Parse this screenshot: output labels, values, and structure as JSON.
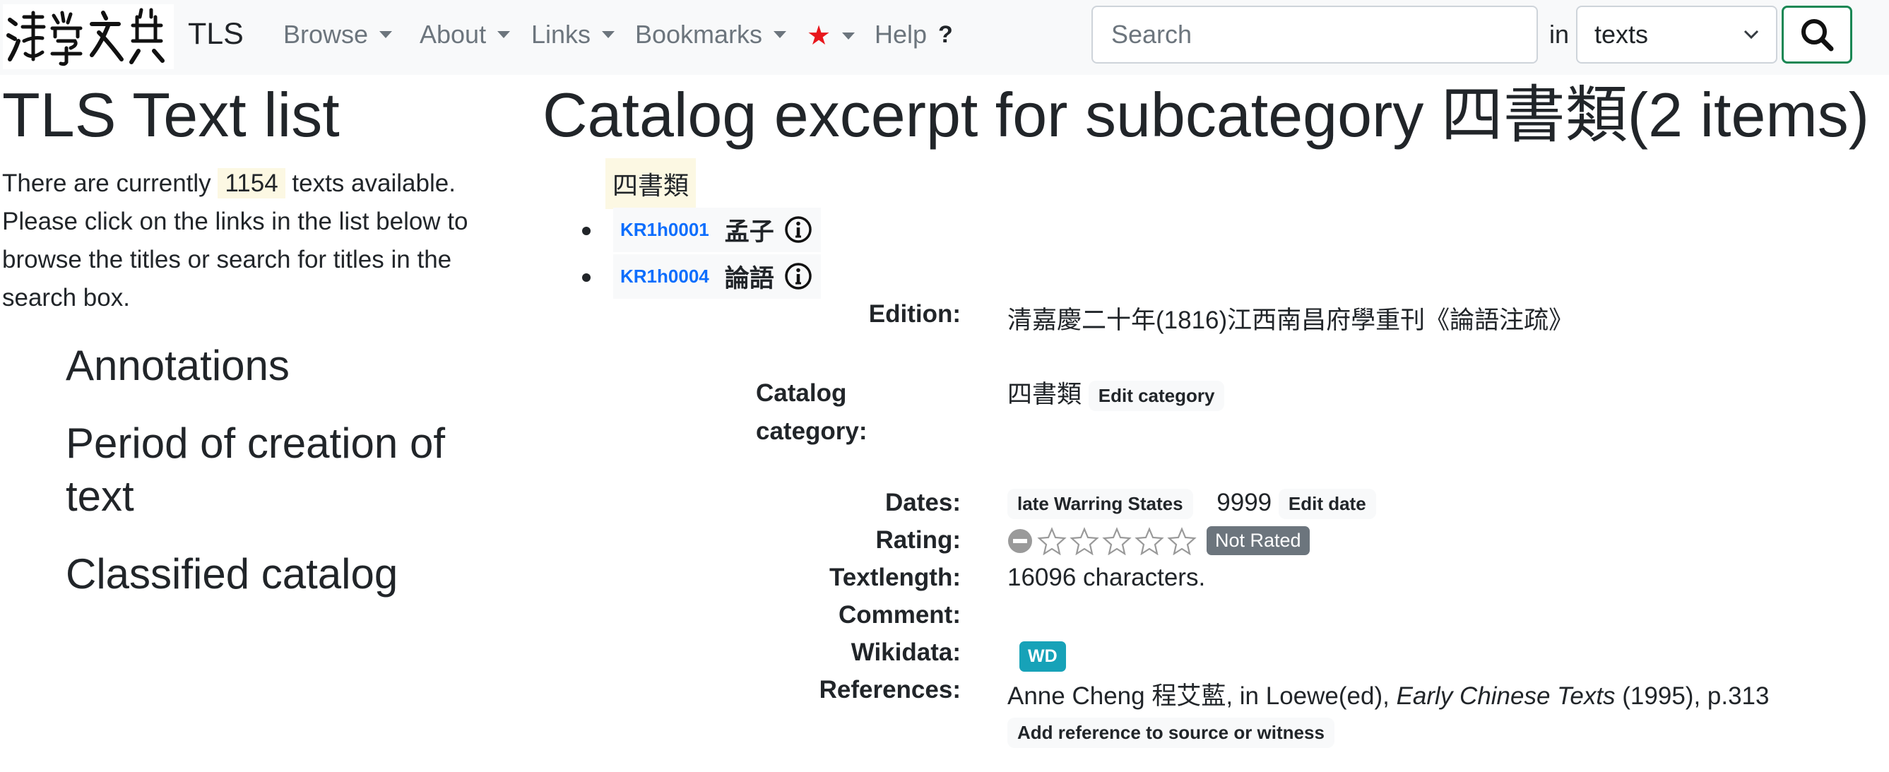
{
  "navbar": {
    "brand": "TLS",
    "items": [
      {
        "label": "Browse"
      },
      {
        "label": "About"
      },
      {
        "label": "Links"
      },
      {
        "label": "Bookmarks"
      }
    ],
    "help": "Help",
    "help_mark": "?",
    "search_placeholder": "Search",
    "in_label": "in",
    "search_scope": "texts",
    "colors": {
      "star": "#e8161c",
      "search_border": "#198754"
    }
  },
  "sidebar": {
    "title": "TLS Text list",
    "intro_before": "There are currently ",
    "count": "1154",
    "intro_after": " texts available. Please click on the links in the list below to browse the titles or search for titles in the search box.",
    "links": [
      "Annotations",
      "Period of creation of text",
      "Classified catalog"
    ]
  },
  "main": {
    "title": "Catalog excerpt for subcategory 四書類(2 items)",
    "category_tag": "四書類",
    "texts": [
      {
        "id": "KR1h0001",
        "title": "孟子"
      },
      {
        "id": "KR1h0004",
        "title": "論語"
      }
    ],
    "details": {
      "edition_label": "Edition:",
      "edition": "清嘉慶二十年(1816)江西南昌府學重刊《論語注疏》",
      "catalog_label_1": "Catalog",
      "catalog_label_2": "category:",
      "catalog": "四書類",
      "edit_category": "Edit category",
      "dates_label": "Dates:",
      "dates_period": "late Warring States",
      "dates_value": "9999",
      "edit_date": "Edit date",
      "rating_label": "Rating:",
      "rating_stars": 0,
      "rating_max": 5,
      "not_rated": "Not Rated",
      "textlength_label": "Textlength:",
      "textlength": "16096 characters.",
      "comment_label": "Comment:",
      "wikidata_label": "Wikidata:",
      "wikidata_badge": "WD",
      "references_label": "References:",
      "ref_author": "Anne Cheng 程艾藍, in Loewe(ed), ",
      "ref_book": "Early Chinese Texts",
      "ref_rest": " (1995), p.313",
      "add_reference": "Add reference to source or witness"
    }
  }
}
